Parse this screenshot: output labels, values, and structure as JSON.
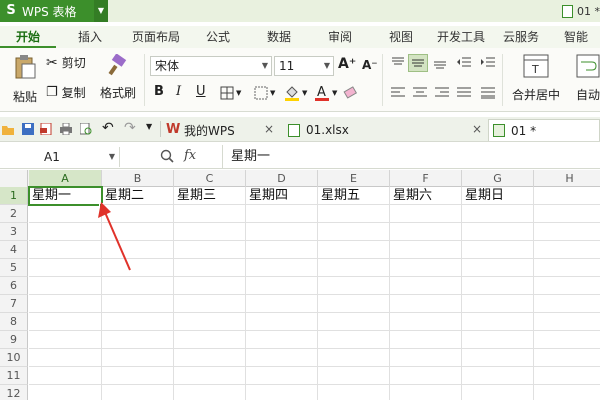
{
  "titlebar": {
    "app_label": "WPS 表格",
    "doc_title": "01 *"
  },
  "ribbon_tabs": [
    "开始",
    "插入",
    "页面布局",
    "公式",
    "数据",
    "审阅",
    "视图",
    "开发工具",
    "云服务",
    "智能"
  ],
  "ribbon": {
    "paste": "粘贴",
    "cut": "剪切",
    "copy": "复制",
    "format_painter": "格式刷",
    "font_name": "宋体",
    "font_size": "11",
    "merge_center": "合并居中",
    "auto": "自动"
  },
  "doc_tabs": [
    {
      "label": "我的WPS"
    },
    {
      "label": "01.xlsx"
    },
    {
      "label": "01 *"
    }
  ],
  "formula_bar": {
    "name_box": "A1",
    "fx_label": "fx",
    "content": "星期一"
  },
  "sheet": {
    "columns": [
      "A",
      "B",
      "C",
      "D",
      "E",
      "F",
      "G",
      "H"
    ],
    "rows": [
      "1",
      "2",
      "3",
      "4",
      "5",
      "6",
      "7",
      "8",
      "9",
      "10",
      "11",
      "12"
    ],
    "row1_values": [
      "星期一",
      "星期二",
      "星期三",
      "星期四",
      "星期五",
      "星期六",
      "星期日"
    ],
    "active_cell": "A1"
  },
  "colors": {
    "accent": "#3c8f2b",
    "annotation_arrow": "#e0322a"
  }
}
